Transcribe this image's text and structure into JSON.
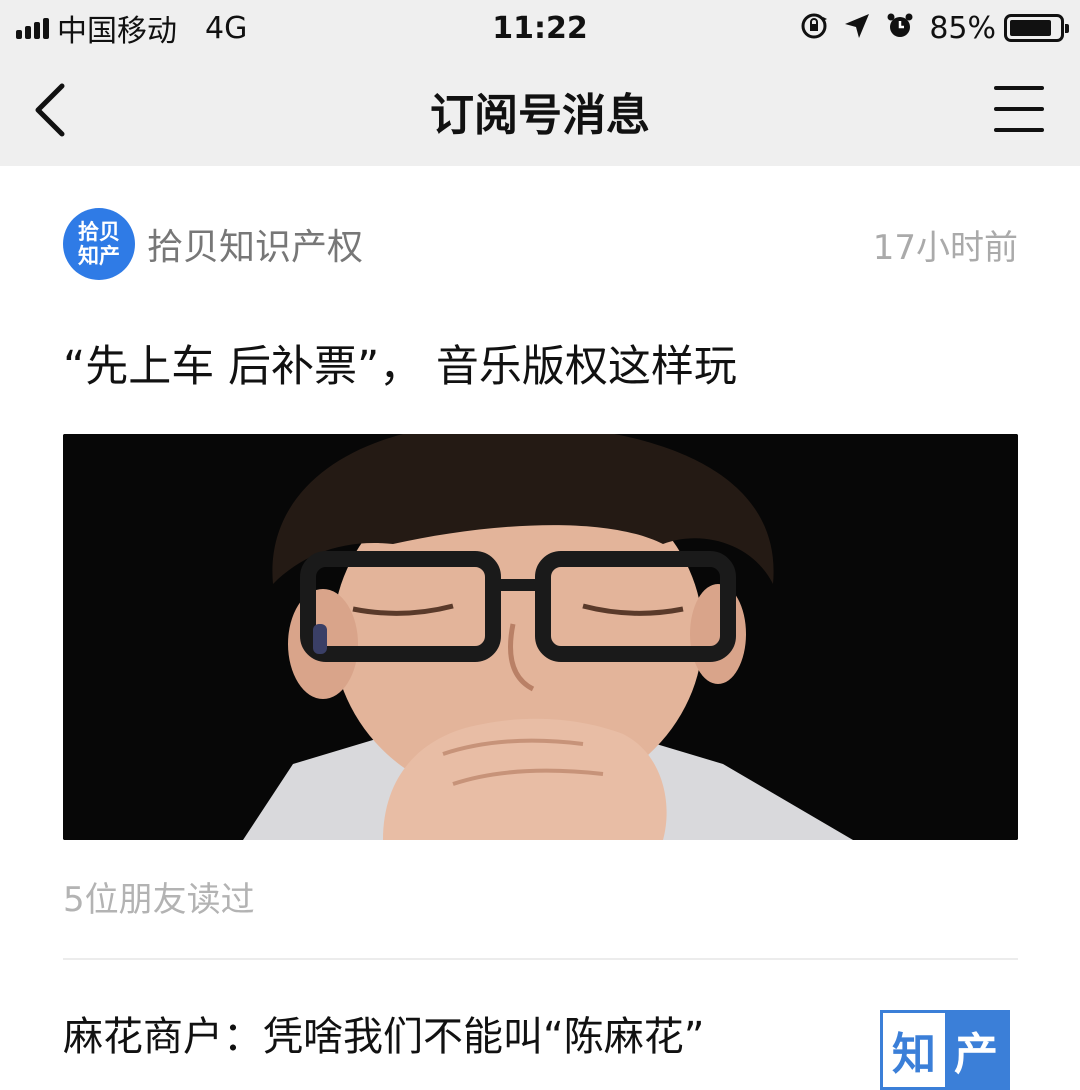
{
  "status_bar": {
    "carrier": "中国移动",
    "network": "4G",
    "time": "11:22",
    "battery_percent": "85%",
    "battery_level": 0.85,
    "icons": [
      "signal-icon",
      "orientation-lock-icon",
      "location-arrow-icon",
      "alarm-icon",
      "battery-icon"
    ]
  },
  "nav": {
    "title": "订阅号消息",
    "back_icon": "chevron-left-icon",
    "menu_icon": "hamburger-menu-icon"
  },
  "card": {
    "account": {
      "avatar_line1": "拾贝",
      "avatar_line2": "知产",
      "name": "拾贝知识产权",
      "time": "17小时前",
      "avatar_color": "#2f7be6"
    },
    "article": {
      "title": "“先上车 后补票”， 音乐版权这样玩",
      "read_count": "5位朋友读过"
    },
    "next_article": {
      "title": "麻花商户：凭啥我们不能叫“陈麻花”",
      "thumb_left": "知",
      "thumb_right": "产",
      "thumb_color": "#3b7fd8"
    }
  }
}
